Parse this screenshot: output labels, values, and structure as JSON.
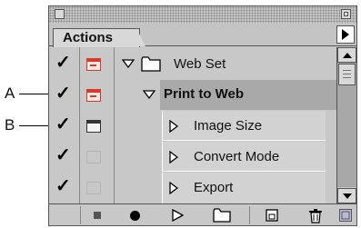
{
  "callouts": {
    "a": "A",
    "b": "B"
  },
  "panel": {
    "tab_label": "Actions"
  },
  "rows": [
    {
      "label": "Web Set",
      "checked": true,
      "dialog": "red",
      "expanded": true,
      "type": "set"
    },
    {
      "label": "Print to Web",
      "checked": true,
      "dialog": "red",
      "expanded": true,
      "type": "action"
    },
    {
      "label": "Image Size",
      "checked": true,
      "dialog": "plain",
      "expanded": false,
      "type": "step"
    },
    {
      "label": "Convert Mode",
      "checked": true,
      "dialog": "ghost",
      "expanded": false,
      "type": "step"
    },
    {
      "label": "Export",
      "checked": true,
      "dialog": "ghost",
      "expanded": false,
      "type": "step"
    }
  ],
  "toolbar": {
    "buttons": [
      "stop-icon",
      "record-icon",
      "play-icon",
      "new-set-icon",
      "new-action-icon",
      "trash-icon"
    ]
  },
  "colors": {
    "accent_red": "#d63a2a",
    "selected_row": "#a9a9a9"
  }
}
